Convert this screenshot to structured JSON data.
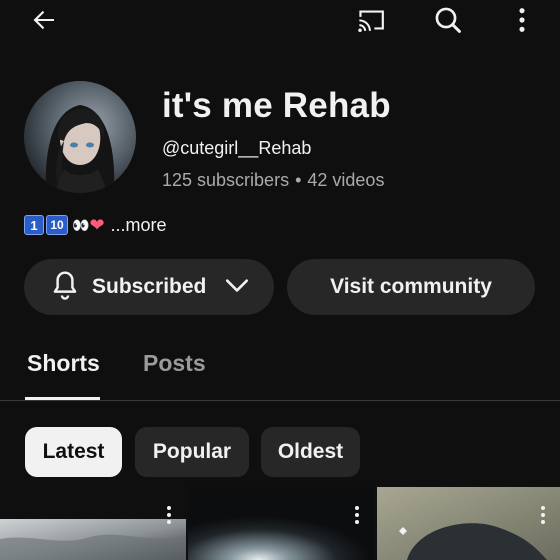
{
  "topbar": {
    "back_icon": "arrow-left-icon",
    "cast_icon": "cast-icon",
    "search_icon": "search-icon",
    "menu_icon": "more-vert-icon"
  },
  "channel": {
    "name": "it's me Rehab",
    "handle": "@cutegirl__Rehab",
    "subscribers": "125 subscribers",
    "separator": "•",
    "videos": "42 videos",
    "avatar_icon": "channel-avatar"
  },
  "description": {
    "badge_one": "1",
    "badge_ten": "10",
    "eyes": "👀",
    "heart": "❤",
    "more": " ...more"
  },
  "actions": {
    "subscribed_label": "Subscribed",
    "community_label": "Visit community"
  },
  "tabs": [
    {
      "label": "Shorts",
      "active": true
    },
    {
      "label": "Posts",
      "active": false
    }
  ],
  "filters": [
    {
      "label": "Latest",
      "selected": true
    },
    {
      "label": "Popular",
      "selected": false
    },
    {
      "label": "Oldest",
      "selected": false
    }
  ],
  "colors": {
    "background": "#0f0f0f",
    "surface": "#272727",
    "text": "#f1f1f1",
    "muted": "#aaaaaa"
  }
}
